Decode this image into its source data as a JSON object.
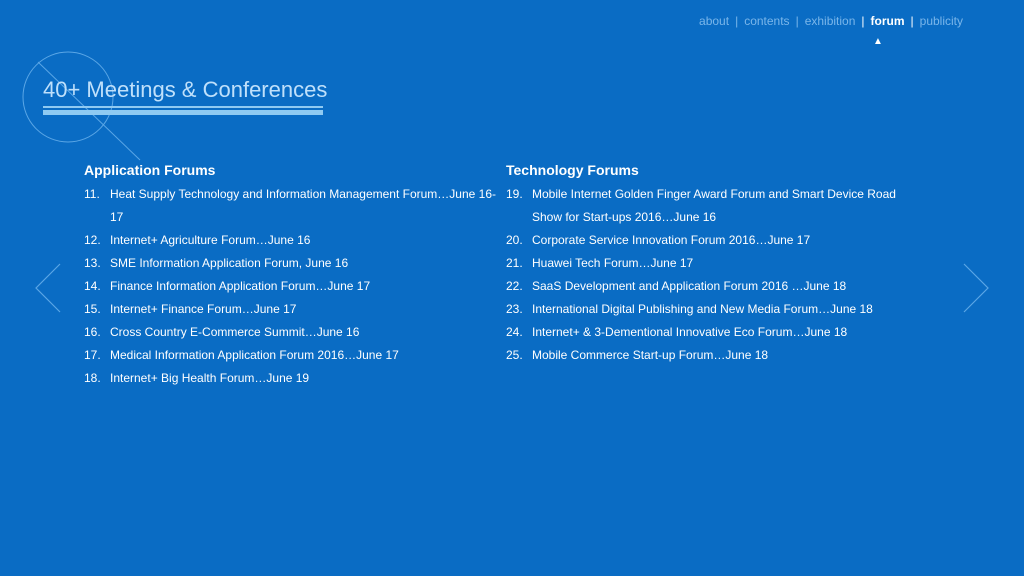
{
  "nav": {
    "items": [
      {
        "label": "about"
      },
      {
        "label": "contents"
      },
      {
        "label": "exhibition"
      },
      {
        "label": "forum"
      },
      {
        "label": "publicity"
      }
    ],
    "active_marker": "▲"
  },
  "heading": "40+ Meetings & Conferences",
  "application": {
    "title": "Application Forums",
    "items": [
      {
        "num": "11.",
        "text": "Heat Supply Technology and Information Management Forum…June 16-17"
      },
      {
        "num": "12.",
        "text": "Internet+ Agriculture Forum…June 16"
      },
      {
        "num": "13.",
        "text": "SME Information Application Forum, June 16"
      },
      {
        "num": "14.",
        "text": "Finance Information Application Forum…June 17"
      },
      {
        "num": "15.",
        "text": "Internet+ Finance Forum…June 17"
      },
      {
        "num": "16.",
        "text": "Cross Country E-Commerce Summit…June 16"
      },
      {
        "num": "17.",
        "text": "Medical Information Application Forum 2016…June 17"
      },
      {
        "num": "18.",
        "text": "Internet+ Big Health Forum…June 19"
      }
    ]
  },
  "technology": {
    "title": "Technology Forums",
    "items": [
      {
        "num": "19.",
        "text": "Mobile Internet Golden Finger Award Forum and Smart Device Road Show for Start-ups 2016…June 16"
      },
      {
        "num": "20.",
        "text": "Corporate Service Innovation Forum 2016…June 17"
      },
      {
        "num": "21.",
        "text": "Huawei Tech Forum…June 17"
      },
      {
        "num": "22.",
        "text": "SaaS Development and Application Forum 2016 …June 18"
      },
      {
        "num": "23.",
        "text": "International Digital Publishing and New Media Forum…June 18"
      },
      {
        "num": "24.",
        "text": "Internet+ & 3-Dementional Innovative Eco Forum…June 18"
      },
      {
        "num": "25.",
        "text": "Mobile Commerce Start-up Forum…June 18"
      }
    ]
  },
  "icons": {
    "prev": "chevron-left-icon",
    "next": "chevron-right-icon"
  },
  "colors": {
    "background": "#0a6cc4",
    "accent": "#8fcaf2",
    "nav_inactive": "#7ab6ea"
  }
}
